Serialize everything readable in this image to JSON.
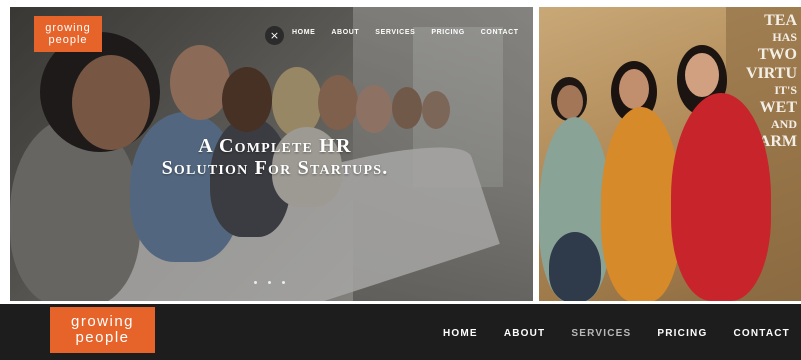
{
  "brand": {
    "line1": "growing",
    "line2": "people",
    "color": "#e6632a"
  },
  "hero": {
    "nav": [
      "HOME",
      "ABOUT",
      "SERVICES",
      "PRICING",
      "CONTACT"
    ],
    "close_icon": "×",
    "title_line1": "A Complete HR",
    "title_line2": "Solution For Startups.",
    "slide_count": 3
  },
  "photo_wall": {
    "lines": [
      "TEA",
      "HAS",
      "TWO",
      "VIRTU",
      "IT'S",
      "WET",
      "AND",
      "WARM"
    ]
  },
  "navbar": {
    "items": [
      {
        "label": "HOME",
        "active": true
      },
      {
        "label": "ABOUT",
        "active": true
      },
      {
        "label": "SERVICES",
        "active": false
      },
      {
        "label": "PRICING",
        "active": true
      },
      {
        "label": "CONTACT",
        "active": true
      }
    ],
    "background": "#1d1d1d"
  }
}
